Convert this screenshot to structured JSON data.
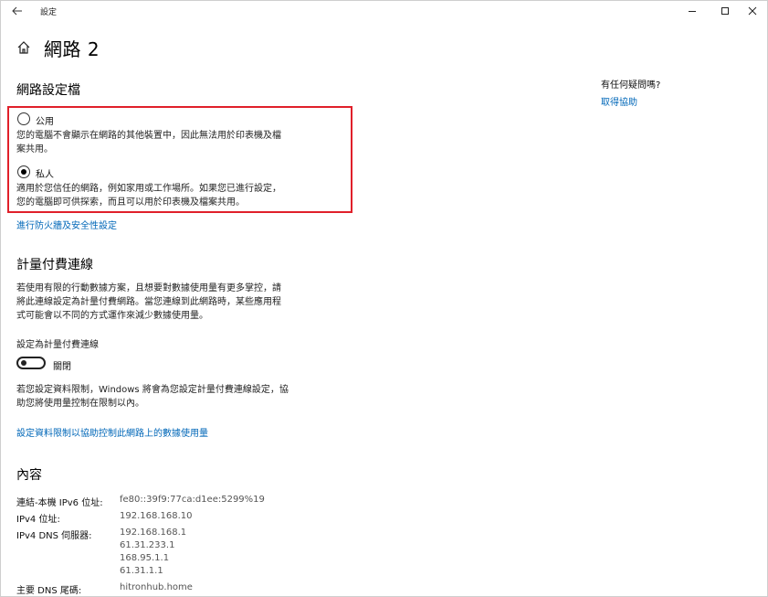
{
  "window": {
    "title": "設定",
    "back_icon": "arrow-left-icon",
    "minimize_icon": "minimize-icon",
    "maximize_icon": "maximize-icon",
    "close_icon": "close-icon"
  },
  "header": {
    "home_icon": "home-icon",
    "title": "網路 2"
  },
  "network_profile": {
    "title": "網路設定檔",
    "options": [
      {
        "label": "公用",
        "description_lines": [
          "您的電腦不會顯示在網路的其他裝置中，因此無法用於印表機及檔",
          "案共用。"
        ],
        "selected": false
      },
      {
        "label": "私人",
        "description_lines": [
          "適用於您信任的網路，例如家用或工作場所。如果您已進行設定，",
          "您的電腦即可供探索，而且可以用於印表機及檔案共用。"
        ],
        "selected": true
      }
    ],
    "firewall_link": "進行防火牆及安全性設定",
    "highlight_color": "#e0202a"
  },
  "metered": {
    "title": "計量付費連線",
    "description_lines": [
      "若使用有限的行動數據方案，且想要對數據使用量有更多掌控，請",
      "將此連線設定為計量付費網路。當您連線到此網路時，某些應用程",
      "式可能會以不同的方式運作來減少數據使用量。"
    ],
    "toggle_caption": "設定為計量付費連線",
    "toggle_state_label": "關閉",
    "toggle_on": false,
    "limit_note_lines": [
      "若您設定資料限制，Windows 將會為您設定計量付費連線設定，協",
      "助您將使用量控制在限制以內。"
    ],
    "data_limit_link": "設定資料限制以協助控制此網路上的數據使用量"
  },
  "properties": {
    "title": "內容",
    "rows": [
      {
        "key": "連結-本機 IPv6 位址:",
        "values": [
          "fe80::39f9:77ca:d1ee:5299%19"
        ]
      },
      {
        "key": "IPv4 位址:",
        "values": [
          "192.168.168.10"
        ]
      },
      {
        "key": "IPv4 DNS 伺服器:",
        "values": [
          "192.168.168.1",
          "61.31.233.1",
          "168.95.1.1",
          "61.31.1.1"
        ]
      },
      {
        "key": "主要 DNS 尾碼:",
        "values": [
          "hitronhub.home"
        ]
      }
    ]
  },
  "help": {
    "title": "有任何疑問嗎?",
    "link": "取得協助"
  },
  "colors": {
    "link": "#0067b8",
    "accent_border": "#e0202a"
  }
}
